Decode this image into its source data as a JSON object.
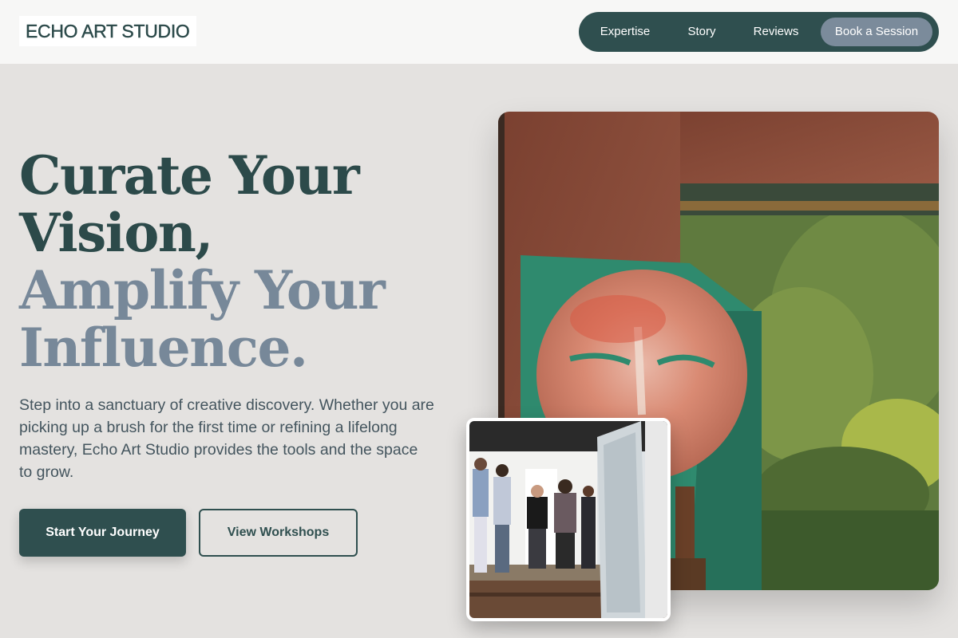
{
  "header": {
    "logo": "ECHO ART STUDIO",
    "nav": [
      {
        "label": "Expertise"
      },
      {
        "label": "Story"
      },
      {
        "label": "Reviews"
      }
    ],
    "cta": "Book a Session"
  },
  "hero": {
    "headline_line1": "Curate Your",
    "headline_line2": "Vision,",
    "headline_line3": "Amplify Your",
    "headline_line4": "Influence.",
    "lede": "Step into a sanctuary of creative discovery. Whether you are picking up a brush for the first time or refining a lifelong mastery, Echo Art Studio provides the tools and the space to grow.",
    "primary_button": "Start Your Journey",
    "secondary_button": "View Workshops"
  },
  "colors": {
    "brand_dark": "#2f4f4f",
    "brand_slate": "#778899",
    "page_bg": "#e4e2e0"
  },
  "images": {
    "main": "mural-sculpture-photo",
    "inset": "gallery-visitors-photo"
  }
}
